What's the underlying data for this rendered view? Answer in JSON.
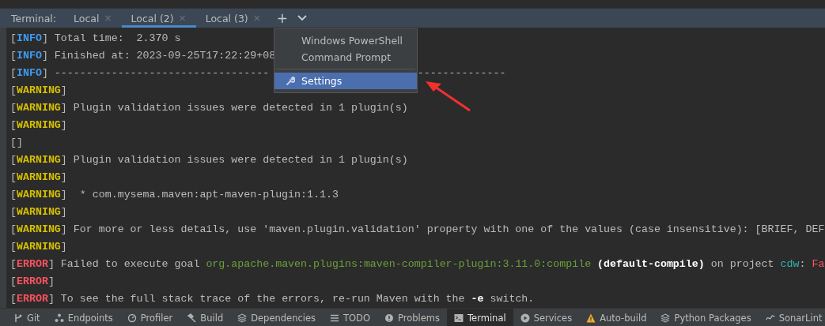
{
  "terminal_tabs": {
    "label": "Terminal:",
    "tabs": [
      {
        "label": "Local",
        "close": "×",
        "selected": false
      },
      {
        "label": "Local (2)",
        "close": "×",
        "selected": true
      },
      {
        "label": "Local (3)",
        "close": "×",
        "selected": false
      }
    ],
    "add": "+"
  },
  "dropdown_menu": {
    "items": [
      {
        "label": "Windows PowerShell",
        "kind": "plain",
        "selected": false
      },
      {
        "label": "Command Prompt",
        "kind": "plain",
        "selected": false
      },
      {
        "label": "Settings",
        "kind": "settings",
        "selected": true
      }
    ]
  },
  "console_lines": [
    {
      "parts": [
        {
          "kind": "plain",
          "text": "["
        },
        {
          "kind": "info",
          "text": "INFO"
        },
        {
          "kind": "plain",
          "text": "] Total time:  2.370 s"
        }
      ]
    },
    {
      "parts": [
        {
          "kind": "plain",
          "text": "["
        },
        {
          "kind": "info",
          "text": "INFO"
        },
        {
          "kind": "plain",
          "text": "] Finished at: 2023-09-25T17:22:29+08"
        }
      ]
    },
    {
      "parts": [
        {
          "kind": "plain",
          "text": "["
        },
        {
          "kind": "info",
          "text": "INFO"
        },
        {
          "kind": "plain",
          "text": "] ----------------------------------"
        },
        {
          "kind": "after_menu",
          "text": "--------------"
        }
      ]
    },
    {
      "parts": [
        {
          "kind": "plain",
          "text": "["
        },
        {
          "kind": "warn",
          "text": "WARNING"
        },
        {
          "kind": "plain",
          "text": "]"
        }
      ]
    },
    {
      "parts": [
        {
          "kind": "plain",
          "text": "["
        },
        {
          "kind": "warn",
          "text": "WARNING"
        },
        {
          "kind": "plain",
          "text": "] Plugin validation issues were detected in 1 plugin(s)"
        }
      ]
    },
    {
      "parts": [
        {
          "kind": "plain",
          "text": "["
        },
        {
          "kind": "warn",
          "text": "WARNING"
        },
        {
          "kind": "plain",
          "text": "]"
        }
      ]
    },
    {
      "parts": [
        {
          "kind": "plain",
          "text": "[]"
        }
      ]
    },
    {
      "parts": [
        {
          "kind": "plain",
          "text": "["
        },
        {
          "kind": "warn",
          "text": "WARNING"
        },
        {
          "kind": "plain",
          "text": "] Plugin validation issues were detected in 1 plugin(s)"
        }
      ]
    },
    {
      "parts": [
        {
          "kind": "plain",
          "text": "["
        },
        {
          "kind": "warn",
          "text": "WARNING"
        },
        {
          "kind": "plain",
          "text": "]"
        }
      ]
    },
    {
      "parts": [
        {
          "kind": "plain",
          "text": "["
        },
        {
          "kind": "warn",
          "text": "WARNING"
        },
        {
          "kind": "plain",
          "text": "]  * com.mysema.maven:apt-maven-plugin:1.1.3"
        }
      ]
    },
    {
      "parts": [
        {
          "kind": "plain",
          "text": "["
        },
        {
          "kind": "warn",
          "text": "WARNING"
        },
        {
          "kind": "plain",
          "text": "]"
        }
      ]
    },
    {
      "parts": [
        {
          "kind": "plain",
          "text": "["
        },
        {
          "kind": "warn",
          "text": "WARNING"
        },
        {
          "kind": "plain",
          "text": "] For more or less details, use 'maven.plugin.validation' property with one of the values (case insensitive): [BRIEF, DEF"
        }
      ]
    },
    {
      "parts": [
        {
          "kind": "plain",
          "text": "["
        },
        {
          "kind": "warn",
          "text": "WARNING"
        },
        {
          "kind": "plain",
          "text": "]"
        }
      ]
    },
    {
      "parts": [
        {
          "kind": "plain",
          "text": "["
        },
        {
          "kind": "err",
          "text": "ERROR"
        },
        {
          "kind": "plain",
          "text": "] Failed to execute goal "
        },
        {
          "kind": "goal",
          "text": "org.apache.maven.plugins:maven-compiler-plugin:3.11.0:compile"
        },
        {
          "kind": "bold",
          "text": " (default-compile)"
        },
        {
          "kind": "plain",
          "text": " on project "
        },
        {
          "kind": "project",
          "text": "cdw"
        },
        {
          "kind": "plain",
          "text": ": "
        },
        {
          "kind": "error",
          "text": "Fa"
        }
      ]
    },
    {
      "parts": [
        {
          "kind": "plain",
          "text": "["
        },
        {
          "kind": "err",
          "text": "ERROR"
        },
        {
          "kind": "plain",
          "text": "]"
        }
      ]
    },
    {
      "parts": [
        {
          "kind": "plain",
          "text": "["
        },
        {
          "kind": "err",
          "text": "ERROR"
        },
        {
          "kind": "plain",
          "text": "] To see the full stack trace of the errors, re-run Maven with the "
        },
        {
          "kind": "bold",
          "text": "-e"
        },
        {
          "kind": "plain",
          "text": " switch."
        }
      ]
    }
  ],
  "tool_windows": [
    {
      "label": "Git",
      "kind": "branch",
      "selected": false
    },
    {
      "label": "Endpoints",
      "kind": "nodes",
      "selected": false
    },
    {
      "label": "Profiler",
      "kind": "gauge",
      "selected": false
    },
    {
      "label": "Build",
      "kind": "hammer",
      "selected": false
    },
    {
      "label": "Dependencies",
      "kind": "layers",
      "selected": false
    },
    {
      "label": "TODO",
      "kind": "list",
      "selected": false
    },
    {
      "label": "Problems",
      "kind": "info",
      "selected": false
    },
    {
      "label": "Terminal",
      "kind": "terminal",
      "selected": true
    },
    {
      "label": "Services",
      "kind": "play",
      "selected": false
    },
    {
      "label": "Auto-build",
      "kind": "warning",
      "selected": false
    },
    {
      "label": "Python Packages",
      "kind": "layers",
      "selected": false
    },
    {
      "label": "SonarLint",
      "kind": "wave",
      "selected": false
    }
  ]
}
